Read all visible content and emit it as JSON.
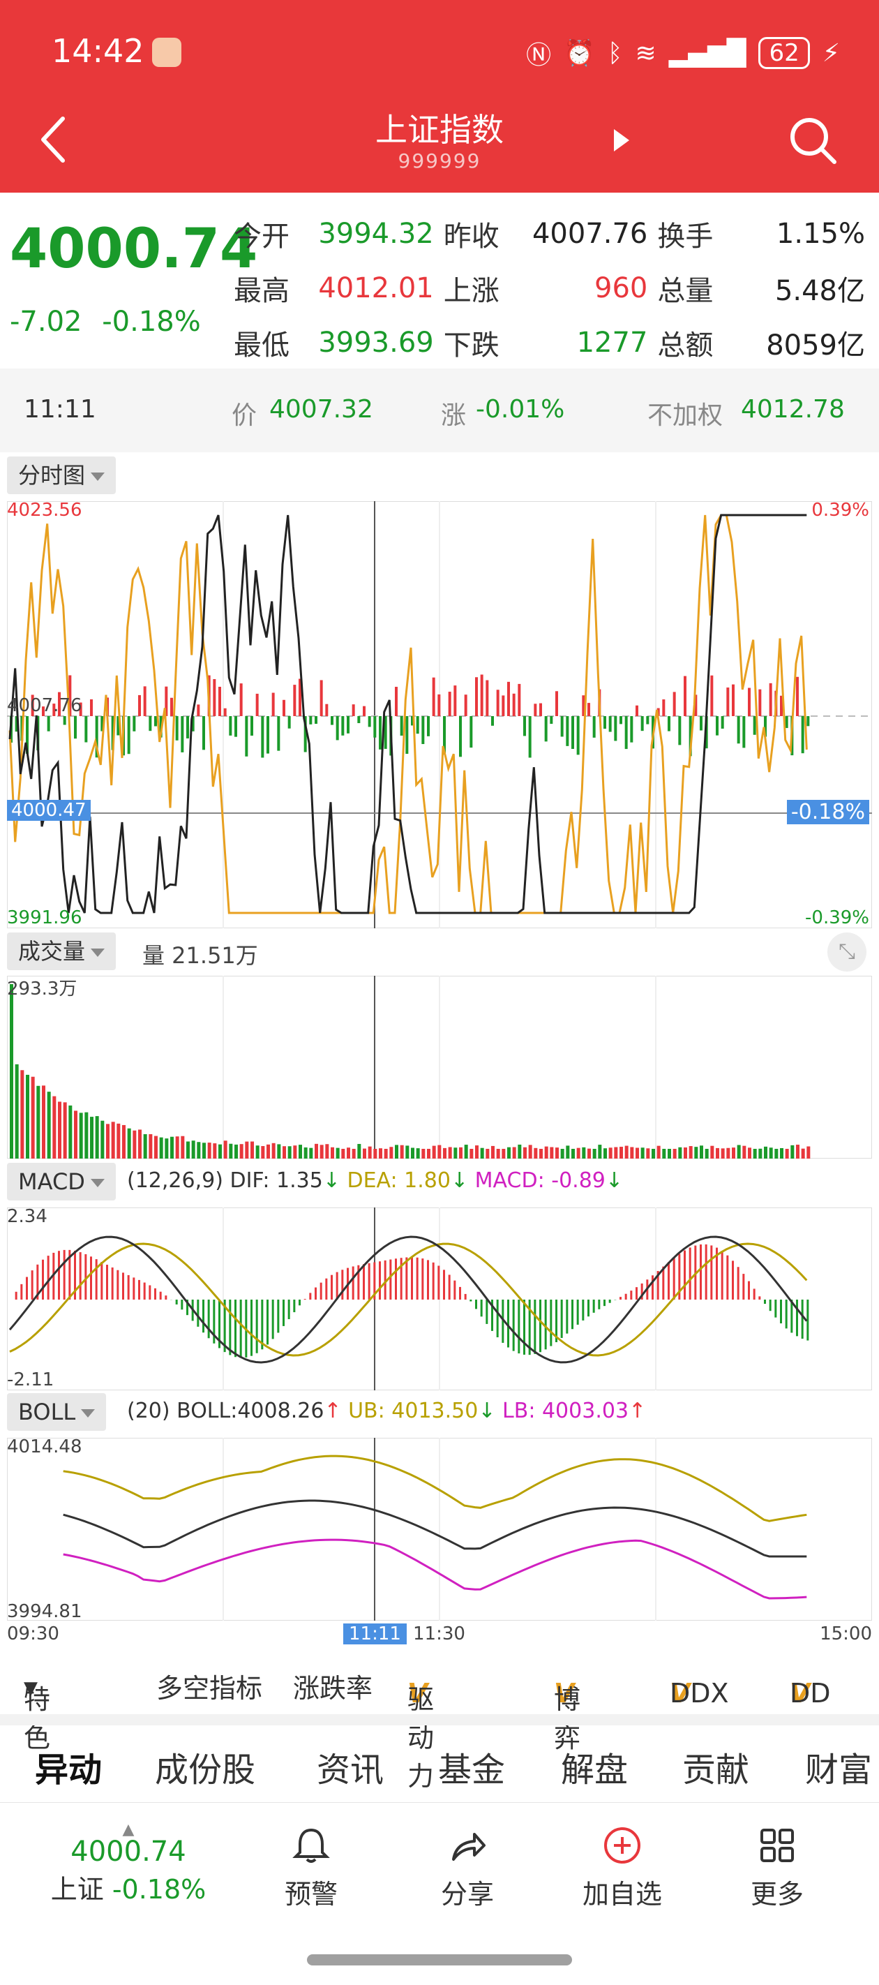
{
  "status": {
    "time": "14:42",
    "battery": "62"
  },
  "header": {
    "title": "上证指数",
    "code": "999999"
  },
  "quote": {
    "price": "4000.74",
    "change": "-7.02",
    "change_pct": "-0.18%",
    "rows": [
      {
        "l1": "今开",
        "v1": "3994.32",
        "l2": "昨收",
        "v2": "4007.76",
        "l3": "换手",
        "v3": "1.15%"
      },
      {
        "l1": "最高",
        "v1": "4012.01",
        "l2": "上涨",
        "v2": "960",
        "l3": "总量",
        "v3": "5.48亿"
      },
      {
        "l1": "最低",
        "v1": "3993.69",
        "l2": "下跌",
        "v2": "1277",
        "l3": "总额",
        "v3": "8059亿"
      }
    ]
  },
  "cursor": {
    "time": "11:11",
    "price_label": "价",
    "price": "4007.32",
    "chg_label": "涨",
    "chg": "-0.01%",
    "nonadj_label": "不加权",
    "nonadj": "4012.78"
  },
  "intraday": {
    "selector": "分时图",
    "high_label": "4023.56",
    "high_pct": "0.39%",
    "prev_close_label": "4007.76",
    "current_label": "4000.47",
    "current_pct": "-0.18%",
    "low_label": "3991.96",
    "low_pct": "-0.39%",
    "ylim": [
      3991.96,
      4023.56
    ]
  },
  "volume": {
    "selector": "成交量",
    "label": "量 21.51万",
    "max_label": "293.3万"
  },
  "macd": {
    "selector": "MACD",
    "params": "(12,26,9)",
    "dif": "DIF: 1.35",
    "dea": "DEA: 1.80",
    "macd": "MACD: -0.89",
    "max_label": "2.34",
    "min_label": "-2.11"
  },
  "boll": {
    "selector": "BOLL",
    "params": "(20)",
    "boll": "BOLL:4008.26",
    "ub": "UB: 4013.50",
    "lb": "LB: 4003.03",
    "max_label": "4014.48",
    "min_label": "3994.81"
  },
  "time_axis": {
    "start": "09:30",
    "cursor": "11:11",
    "mid": "11:30",
    "end": "15:00"
  },
  "indicators": {
    "feature": "特色",
    "items": [
      "多空指标",
      "涨跌率",
      "驱动力",
      "博弈",
      "DDX",
      "DD"
    ]
  },
  "tabs": [
    "异动",
    "成份股",
    "资讯",
    "基金",
    "解盘",
    "贡献",
    "财富"
  ],
  "bottom": {
    "price": "4000.74",
    "name": "上证",
    "pct": "-0.18%",
    "alert": "预警",
    "share": "分享",
    "add": "加自选",
    "more": "更多"
  },
  "colors": {
    "red": "#e8373c",
    "green": "#1a9a2a",
    "header": "#e8383a",
    "orange": "#e8a020"
  }
}
